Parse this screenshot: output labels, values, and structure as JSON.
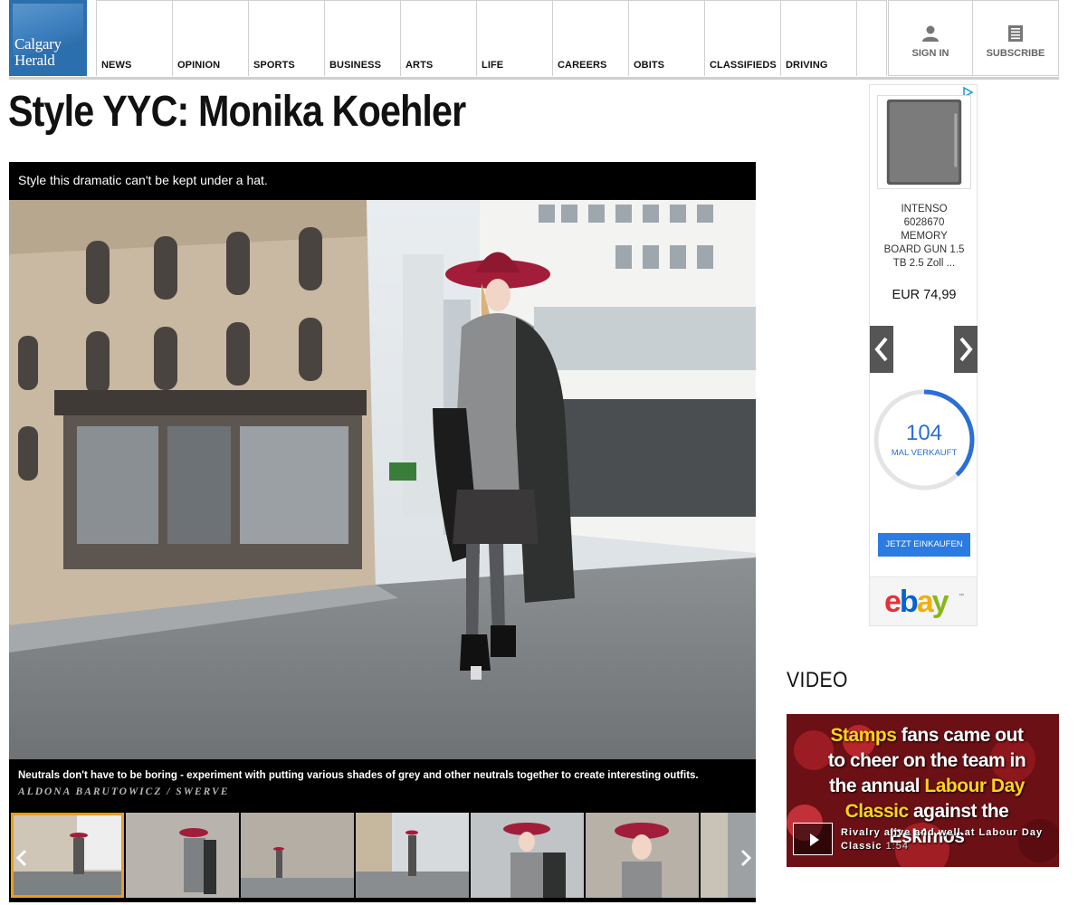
{
  "brand": {
    "logo_text": "Calgary Herald"
  },
  "nav": {
    "items": [
      {
        "label": "NEWS"
      },
      {
        "label": "OPINION"
      },
      {
        "label": "SPORTS"
      },
      {
        "label": "BUSINESS"
      },
      {
        "label": "ARTS"
      },
      {
        "label": "LIFE"
      },
      {
        "label": "CAREERS"
      },
      {
        "label": "OBITS"
      },
      {
        "label": "CLASSIFIEDS"
      },
      {
        "label": "DRIVING"
      }
    ],
    "sign_in": "SIGN IN",
    "subscribe": "SUBSCRIBE"
  },
  "article": {
    "title": "Style YYC: Monika Koehler"
  },
  "gallery": {
    "dek": "Style this dramatic can't be kept under a hat.",
    "caption": "Neutrals don't have to be boring - experiment with putting various shades of grey and other neutrals together to create interesting outfits.",
    "credit": "ALDONA BARUTOWICZ / SWERVE",
    "thumbnail_count": 7,
    "selected_thumbnail": 1
  },
  "ad": {
    "product_name": "INTENSO 6028670 MEMORY BOARD GUN 1.5 TB 2.5 Zoll ...",
    "price": "EUR 74,99",
    "sold_count": "104",
    "sold_label": "MAL VERKAUFT",
    "shop_button": "JETZT EINKAUFEN",
    "brand": "ebay",
    "brand_letters": [
      "e",
      "b",
      "a",
      "y"
    ],
    "brand_colors": [
      "#e53238",
      "#0064d2",
      "#f5af02",
      "#86b817"
    ],
    "ring_fraction": 0.38
  },
  "video": {
    "section_title": "VIDEO",
    "overlay_lines": [
      {
        "parts": [
          {
            "t": "Stamps",
            "y": true
          },
          {
            "t": " fans came out",
            "y": false
          }
        ]
      },
      {
        "parts": [
          {
            "t": "to cheer on the team in",
            "y": false
          }
        ]
      },
      {
        "parts": [
          {
            "t": "the annual ",
            "y": false
          },
          {
            "t": "Labour Day",
            "y": true
          }
        ]
      },
      {
        "parts": [
          {
            "t": "Classic",
            "y": true
          },
          {
            "t": " against the",
            "y": false
          }
        ]
      },
      {
        "parts": [
          {
            "t": "Eskimos",
            "y": false
          }
        ]
      }
    ],
    "title": "Rivalry alive and well at Labour Day Classic",
    "duration": "1:54"
  }
}
